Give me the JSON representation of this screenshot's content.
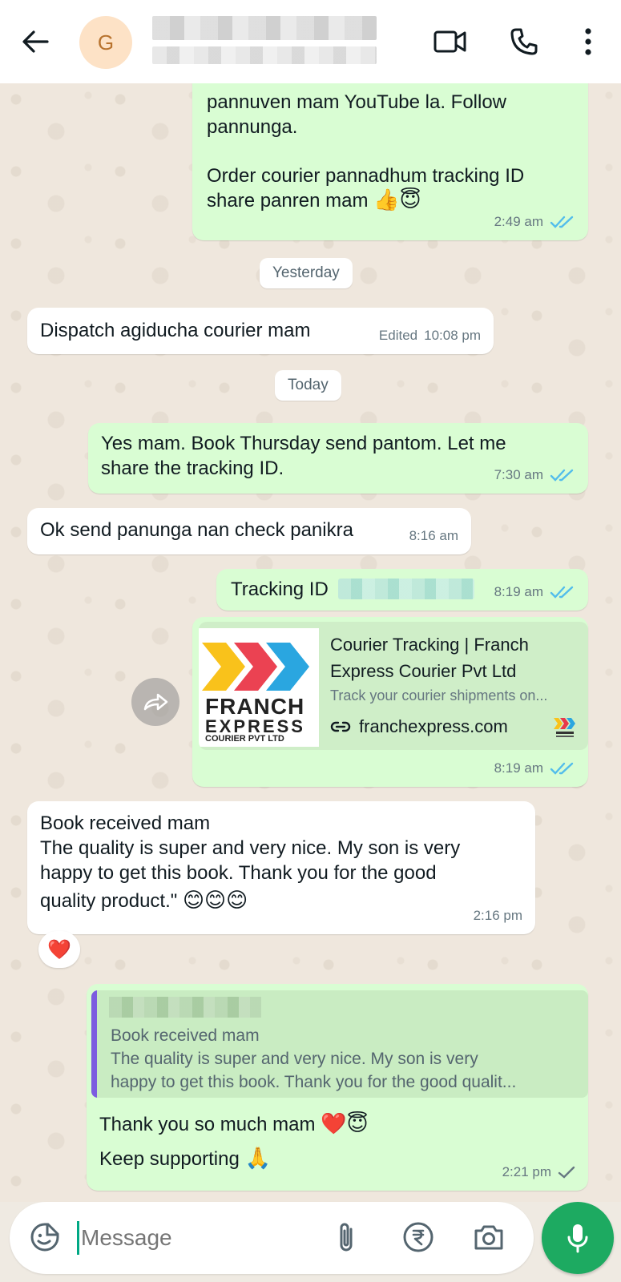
{
  "header": {
    "back_icon": "arrow-left-icon",
    "avatar_initial": "G",
    "contact_name": "",
    "contact_status": "",
    "icons": [
      "video-call-icon",
      "voice-call-icon",
      "more-vert-icon"
    ]
  },
  "messages": [
    {
      "direction": "out",
      "lines": [
        "pannuven mam YouTube la. Follow",
        "pannunga."
      ],
      "lines2": [
        "Order courier pannadhum tracking ID",
        "share panren mam"
      ],
      "emoji": "👍😇",
      "time": "2:49 am"
    },
    {
      "type": "date",
      "label": "Yesterday"
    },
    {
      "direction": "in",
      "text": "Dispatch agiducha courier mam",
      "edited": "Edited",
      "time": "10:08 pm"
    },
    {
      "type": "date",
      "label": "Today"
    },
    {
      "direction": "out",
      "lines": [
        "Yes mam. Book Thursday send pantom. Let me",
        "share the tracking ID."
      ],
      "time": "7:30 am"
    },
    {
      "direction": "in",
      "text": "Ok send panunga nan check panikra",
      "time": "8:16 am"
    },
    {
      "direction": "out",
      "text": "Tracking ID",
      "time": "8:19 am"
    },
    {
      "direction": "out",
      "preview": {
        "title": "Courier Tracking | Franch Express Courier Pvt Ltd",
        "description": "Track your courier shipments on...",
        "domain": "franchexpress.com",
        "logo_lines": [
          "FRANCH",
          "EXPRESS",
          "COURIER PVT LTD"
        ]
      },
      "time": "8:19 am"
    },
    {
      "direction": "in",
      "lines": [
        "Book received mam",
        "The quality is super and very nice. My son is very",
        "happy to get this book. Thank you for the good",
        "quality product.\""
      ],
      "emoji": "😊😊😊",
      "time": "2:16 pm",
      "reaction": "❤️"
    },
    {
      "direction": "out",
      "quote": {
        "author": "",
        "lines": [
          "Book received mam",
          "The quality is super and very nice. My son is very",
          "happy to get this book. Thank you for the good qualit..."
        ]
      },
      "lines": [
        "Thank you so much mam",
        "Keep supporting"
      ],
      "emoji1": "❤️😇",
      "emoji2": "🙏",
      "time": "2:21 pm"
    }
  ],
  "composer": {
    "placeholder": "Message",
    "icons": [
      "sticker-icon",
      "attach-icon",
      "rupee-payment-icon",
      "camera-icon",
      "mic-icon"
    ]
  },
  "colors": {
    "outgoing_bubble": "#d9fdd3",
    "incoming_bubble": "#ffffff",
    "read_ticks": "#53bdeb",
    "accent_green": "#1daa61"
  }
}
